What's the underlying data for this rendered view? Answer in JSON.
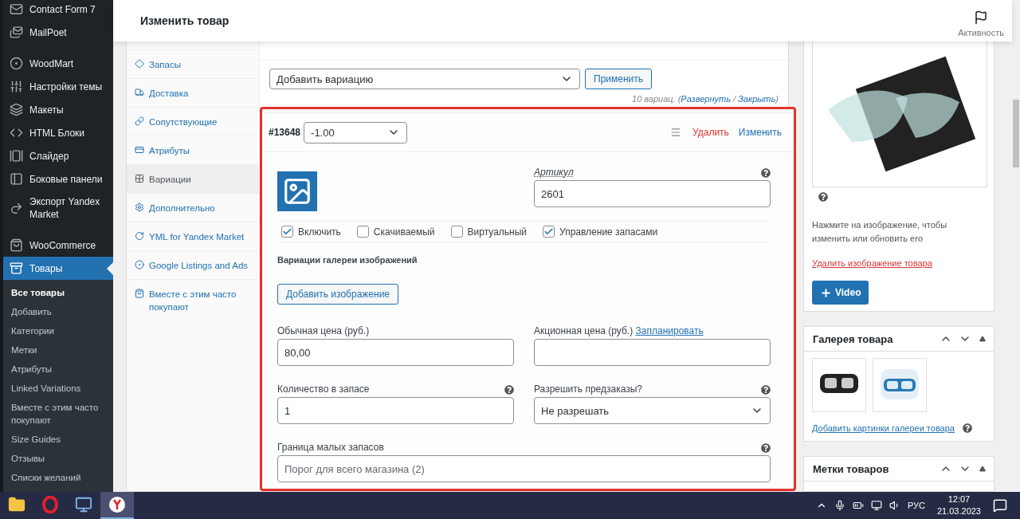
{
  "sidebar": {
    "groups": [
      [
        {
          "label": "Contact Form 7",
          "selected": false
        },
        {
          "label": "MailPoet",
          "selected": false
        }
      ],
      [
        {
          "label": "WoodMart",
          "selected": false
        },
        {
          "label": "Настройки темы",
          "selected": false
        },
        {
          "label": "Макеты",
          "selected": false
        },
        {
          "label": "HTML Блоки",
          "selected": false
        },
        {
          "label": "Слайдер",
          "selected": false
        },
        {
          "label": "Боковые панели",
          "selected": false
        },
        {
          "label": "Экспорт Yandex Market",
          "selected": false
        }
      ],
      [
        {
          "label": "WooCommerce",
          "selected": false
        },
        {
          "label": "Товары",
          "selected": true
        }
      ]
    ],
    "submenu": [
      {
        "label": "Все товары",
        "selected": true
      },
      {
        "label": "Добавить",
        "selected": false
      },
      {
        "label": "Категории",
        "selected": false
      },
      {
        "label": "Метки",
        "selected": false
      },
      {
        "label": "Атрибуты",
        "selected": false
      },
      {
        "label": "Linked Variations",
        "selected": false
      },
      {
        "label": "Вместе с этим часто покупают",
        "selected": false
      },
      {
        "label": "Size Guides",
        "selected": false
      },
      {
        "label": "Отзывы",
        "selected": false
      },
      {
        "label": "Списки желаний",
        "selected": false
      }
    ]
  },
  "header": {
    "title": "Изменить товар",
    "activity": "Активность"
  },
  "product_tabs": [
    {
      "label": "Запасы",
      "selected": false
    },
    {
      "label": "Доставка",
      "selected": false
    },
    {
      "label": "Сопутствующие",
      "selected": false
    },
    {
      "label": "Атрибуты",
      "selected": false
    },
    {
      "label": "Вариации",
      "selected": true
    },
    {
      "label": "Дополнительно",
      "selected": false
    },
    {
      "label": "YML for Yandex Market",
      "selected": false
    },
    {
      "label": "Google Listings and Ads",
      "selected": false
    },
    {
      "label": "Вместе с этим часто покупают",
      "selected": false
    }
  ],
  "variations_toolbar": {
    "select": "Добавить вариацию",
    "apply_button": "Применить",
    "summary": {
      "prefix": "10 вариац. (",
      "expand": "Развернуть",
      "separator": " / ",
      "collapse": "Закрыть",
      "suffix": ")"
    }
  },
  "variation": {
    "id": "#13648",
    "attribute": "-1.00",
    "delete": "Удалить",
    "edit": "Изменить",
    "sku": {
      "label": "Артикул",
      "value": "2601",
      "help": true
    },
    "options": [
      {
        "label": "Включить",
        "checked": true
      },
      {
        "label": "Скачиваемый",
        "checked": false
      },
      {
        "label": "Виртуальный",
        "checked": false
      },
      {
        "label": "Управление запасами",
        "checked": true
      }
    ],
    "gallery_title": "Вариации галереи изображений",
    "add_image_button": "Добавить изображение",
    "fields": [
      {
        "kind": "text",
        "label": "Обычная цена (руб.)",
        "value": "80,00",
        "help": false,
        "full_width": false
      },
      {
        "kind": "text",
        "label": "Акционная цена (руб.)",
        "link": "Запланировать",
        "help": false,
        "full_width": false
      },
      {
        "kind": "text",
        "label": "Количество в запасе",
        "value": "1",
        "help": true,
        "full_width": false
      },
      {
        "kind": "select",
        "label": "Разрешить предзаказы?",
        "value": "Не разрешать",
        "help": true,
        "full_width": false
      },
      {
        "kind": "text",
        "label": "Граница малых запасов",
        "placeholder": "Порог для всего магазина (2)",
        "help": true,
        "full_width": true
      }
    ]
  },
  "product_image": {
    "hint": "Нажмите на изображение, чтобы изменить или обновить его",
    "remove_link": "Удалить изображение товара",
    "video_button": "Video"
  },
  "gallery": {
    "title": "Галерея товара",
    "add_link": "Добавить картинки галереи товара"
  },
  "tags_box": {
    "title": "Метки товаров"
  },
  "taskbar": {
    "apps": [
      {
        "selected": false
      },
      {
        "selected": false
      },
      {
        "selected": false
      },
      {
        "selected": true
      }
    ],
    "language": "РУС",
    "time": "12:07",
    "date": "21.03.2023"
  }
}
